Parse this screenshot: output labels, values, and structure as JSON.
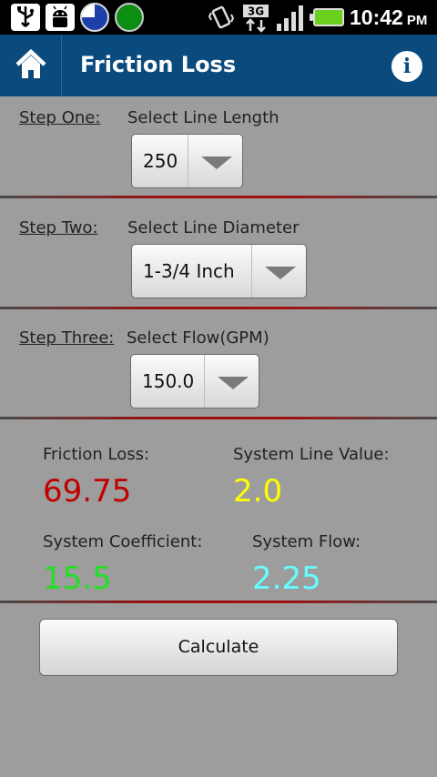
{
  "status_bar": {
    "time": "10:42",
    "ampm": "PM",
    "network": "3G",
    "icons": [
      "usb-icon",
      "android-debug-icon",
      "pie-progress-icon",
      "green-circle-icon",
      "vibrate-icon",
      "3g-data-icon",
      "signal-icon",
      "battery-icon"
    ]
  },
  "header": {
    "title": "Friction Loss",
    "home_icon": "home-icon",
    "info_icon": "info-icon",
    "info_glyph": "i",
    "color": "#0b4a7d"
  },
  "steps": [
    {
      "label": "Step One:",
      "description": "Select Line Length",
      "selected": "250"
    },
    {
      "label": "Step Two:",
      "description": "Select Line Diameter",
      "selected": "1-3/4 Inch"
    },
    {
      "label": "Step Three:",
      "description": "Select Flow(GPM)",
      "selected": "150.0"
    }
  ],
  "results": {
    "friction_loss": {
      "label": "Friction Loss:",
      "value": "69.75",
      "color": "#c00000"
    },
    "system_line_value": {
      "label": "System Line Value:",
      "value": "2.0",
      "color": "#ffff00"
    },
    "system_coefficient": {
      "label": "System Coefficient:",
      "value": "15.5",
      "color": "#22e022"
    },
    "system_flow": {
      "label": "System Flow:",
      "value": "2.25",
      "color": "#66ffff"
    }
  },
  "calculate": {
    "label": "Calculate"
  }
}
